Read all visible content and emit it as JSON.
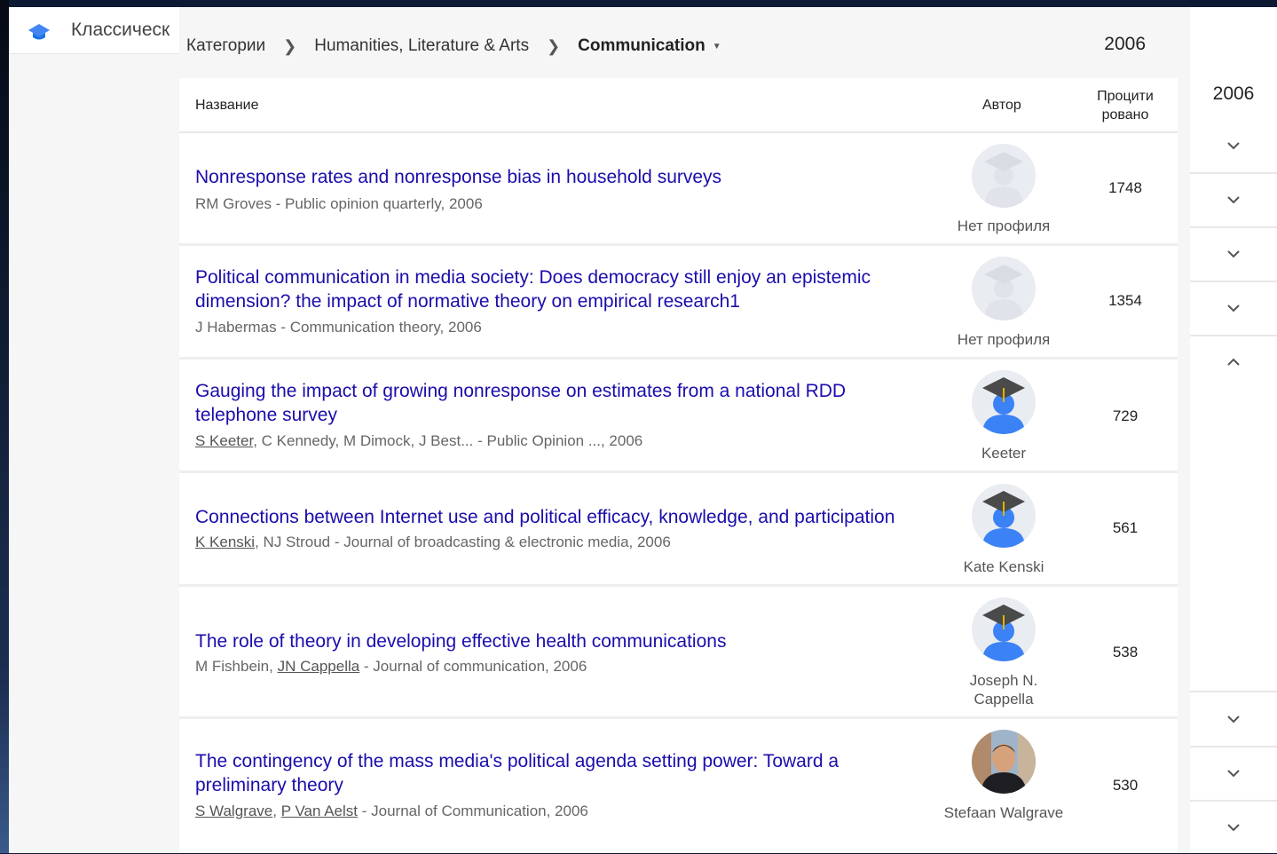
{
  "app": {
    "title": "Классическ",
    "logo_icon": "scholar-cap-icon"
  },
  "breadcrumb": {
    "root": "Категории",
    "category": "Humanities, Literature & Arts",
    "current": "Communication"
  },
  "year": "2006",
  "table": {
    "headers": {
      "title": "Название",
      "author": "Автор",
      "cited": "Процити рованo"
    },
    "rows": [
      {
        "title": "Nonresponse rates and nonresponse bias in household surveys",
        "meta_text": "RM Groves - Public opinion quarterly, 2006",
        "author_name": "Нет профиля",
        "cited": "1748"
      },
      {
        "title": "Political communication in media society: Does democracy still enjoy an epistemic dimension? the impact of normative theory on empirical research1",
        "meta_text": "J Habermas - Communication theory, 2006",
        "author_name": "Нет профиля",
        "cited": "1354"
      },
      {
        "title": "Gauging the impact of growing nonresponse on estimates from a national RDD telephone survey",
        "meta_link": "S Keeter",
        "meta_rest": ", C Kennedy, M Dimock, J Best... - Public Opinion ..., 2006",
        "author_name": "Keeter",
        "cited": "729"
      },
      {
        "title": "Connections between Internet use and political efficacy, knowledge, and participation",
        "meta_link": "K Kenski",
        "meta_rest": ", NJ Stroud - Journal of broadcasting & electronic media, 2006",
        "author_name": "Kate Kenski",
        "cited": "561"
      },
      {
        "title": "The role of theory in developing effective health communications",
        "meta_pre": "M Fishbein, ",
        "meta_link": "JN Cappella",
        "meta_rest": " - Journal of communication, 2006",
        "author_name": "Joseph N. Cappella",
        "cited": "538"
      },
      {
        "title": "The contingency of the mass media's political agenda setting power: Toward a preliminary theory",
        "meta_link": "S Walgrave",
        "meta_sep": ", ",
        "meta_link2": "P Van Aelst",
        "meta_rest": " - Journal of Communication, 2006",
        "author_name": "Stefaan Walgrave",
        "cited": "530"
      }
    ]
  },
  "side": {
    "year": "2006"
  }
}
